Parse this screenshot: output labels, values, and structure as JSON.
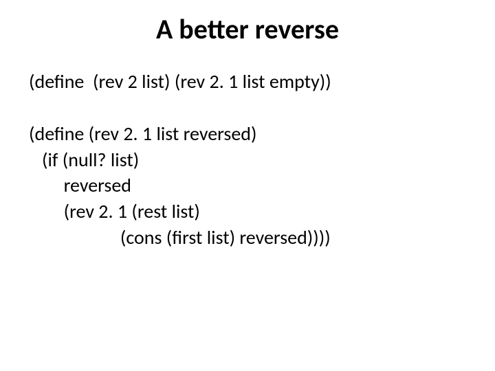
{
  "title": "A better reverse",
  "code": {
    "l1": "(define  (rev 2 list) (rev 2. 1 list empty))",
    "l2": "(define (rev 2. 1 list reversed)",
    "l3": "   (if (null? list)",
    "l4": "        reversed",
    "l5": "        (rev 2. 1 (rest list)",
    "l6": "                     (cons (first list) reversed))))"
  }
}
